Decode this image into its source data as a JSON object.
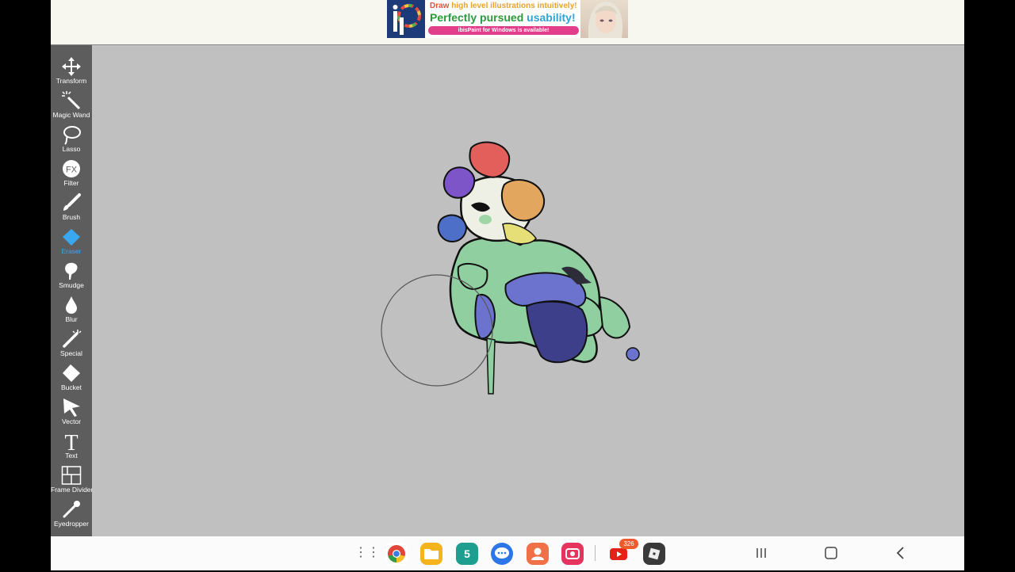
{
  "ad": {
    "line1_pre": "Draw",
    "line1_post": "high level illustrations intuitively!",
    "line2_pre": "Perfectly pursued",
    "line2_hl": "usability!",
    "pill": "ibisPaint for Windows is available!"
  },
  "tools": [
    {
      "label": "Transform",
      "icon": "transform-icon"
    },
    {
      "label": "Magic Wand",
      "icon": "magic-wand-icon"
    },
    {
      "label": "Lasso",
      "icon": "lasso-icon"
    },
    {
      "label": "Filter",
      "icon": "fx-icon",
      "icon_text": "FX"
    },
    {
      "label": "Brush",
      "icon": "brush-icon"
    },
    {
      "label": "Eraser",
      "icon": "eraser-icon",
      "active": true
    },
    {
      "label": "Smudge",
      "icon": "smudge-icon"
    },
    {
      "label": "Blur",
      "icon": "blur-icon"
    },
    {
      "label": "Special",
      "icon": "special-icon"
    },
    {
      "label": "Bucket",
      "icon": "bucket-icon"
    },
    {
      "label": "Vector",
      "icon": "vector-icon"
    },
    {
      "label": "Text",
      "icon": "text-icon",
      "icon_text": "T"
    },
    {
      "label": "Frame Divider",
      "icon": "frame-divider-icon"
    },
    {
      "label": "Eyedropper",
      "icon": "eyedropper-icon"
    }
  ],
  "taskbar": {
    "apps": [
      "app-drawer-icon",
      "chrome-icon",
      "files-icon",
      "calendar-icon",
      "messages-icon",
      "contacts-icon",
      "screen-recorder-icon",
      "youtube-icon",
      "roblox-icon"
    ],
    "calendar_day": "5",
    "youtube_badge": "326"
  },
  "colors": {
    "toolbar_bg": "#5d5d5d",
    "canvas_bg": "#c0c0c0",
    "active_tool": "#39a8f0"
  }
}
